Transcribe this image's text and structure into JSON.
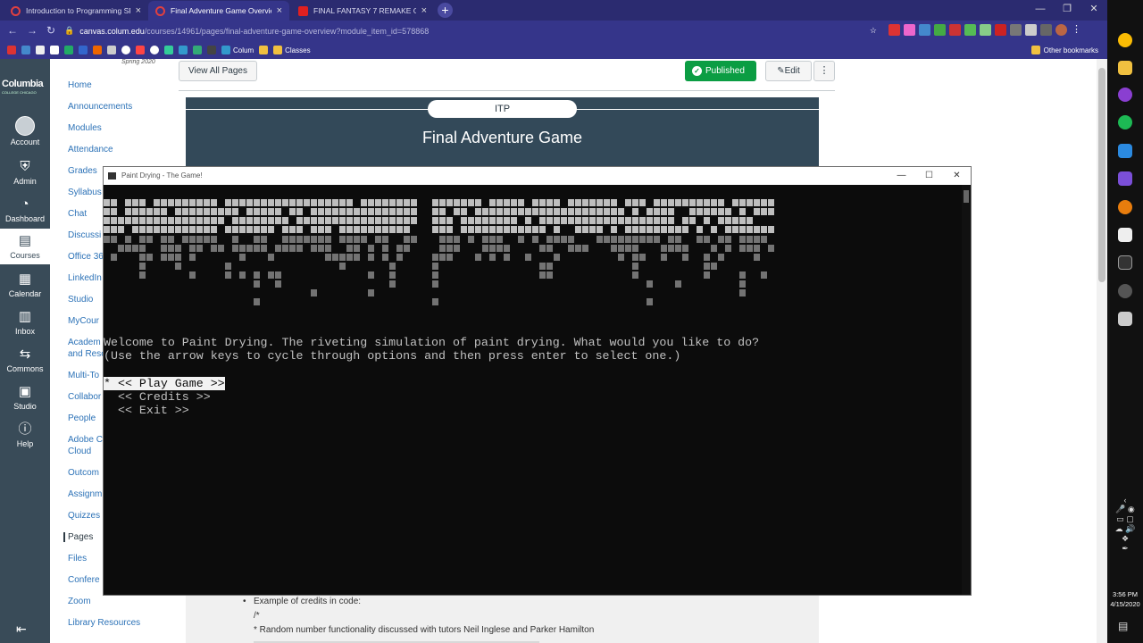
{
  "browser": {
    "tabs": [
      {
        "title": "Introduction to Programming SP",
        "active": false
      },
      {
        "title": "Final Adventure Game Overview",
        "active": true
      },
      {
        "title": "FINAL FANTASY 7 REMAKE Game",
        "active": false
      }
    ],
    "url_host": "canvas.colum.edu",
    "url_path": "/courses/14961/pages/final-adventure-game-overview?module_item_id=578868",
    "bookmarks": [
      "Colum",
      "Classes"
    ],
    "other_bookmarks": "Other bookmarks"
  },
  "global_nav": {
    "logo": "Columbia",
    "logo_sub": "COLLEGE CHICAGO",
    "items": [
      {
        "label": "Account",
        "icon": "account-icon"
      },
      {
        "label": "Admin",
        "icon": "shield-icon"
      },
      {
        "label": "Dashboard",
        "icon": "dashboard-icon"
      },
      {
        "label": "Courses",
        "icon": "book-icon"
      },
      {
        "label": "Calendar",
        "icon": "calendar-icon"
      },
      {
        "label": "Inbox",
        "icon": "inbox-icon"
      },
      {
        "label": "Commons",
        "icon": "commons-icon"
      },
      {
        "label": "Studio",
        "icon": "studio-icon"
      },
      {
        "label": "Help",
        "icon": "help-icon"
      }
    ]
  },
  "course_nav": {
    "term": "Spring 2020",
    "items": [
      "Home",
      "Announcements",
      "Modules",
      "Attendance",
      "Grades",
      "Syllabus",
      "Chat",
      "Discussi",
      "Office 36",
      "LinkedIn",
      "Studio",
      "MyCour",
      "Academ",
      "and Reso",
      "Multi-To",
      "Collabor",
      "People",
      "Adobe C",
      "Cloud",
      "Outcom",
      "Assignm",
      "Quizzes",
      "Pages",
      "Files",
      "Confere",
      "Zoom",
      "Library Resources"
    ],
    "active": "Pages"
  },
  "page": {
    "view_all": "View All Pages",
    "published": "Published",
    "edit": "Edit",
    "banner_pill": "ITP",
    "title": "Final Adventure Game",
    "credits_bullet": "Example of credits in code:",
    "credits_comment": "/*",
    "credits_line": "* Random number functionality discussed with tutors Neil Inglese and Parker Hamilton"
  },
  "console": {
    "window_title": "Paint Drying - The Game!",
    "welcome": "Welcome to Paint Drying. The riveting simulation of paint drying. What would you like to do?",
    "instructions": "(Use the arrow keys to cycle through options and then press enter to select one.)",
    "menu": [
      "* << Play Game >>",
      "  << Credits >>",
      "  << Exit >>"
    ],
    "selected_index": 0
  },
  "taskbar": {
    "time": "3:56 PM",
    "date": "4/15/2020"
  }
}
